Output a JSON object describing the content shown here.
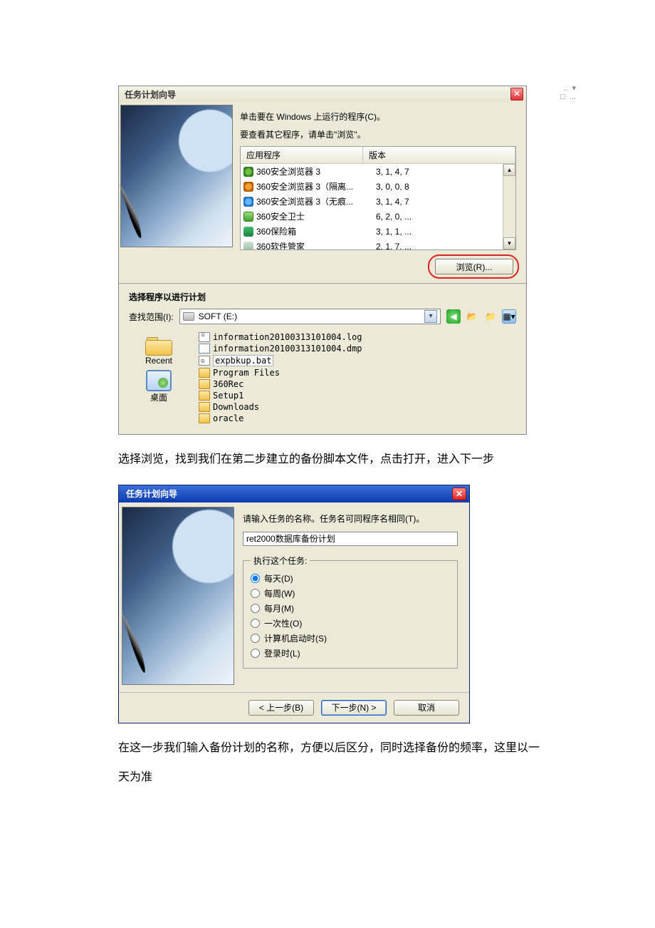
{
  "dlg1": {
    "title": "任务计划向导",
    "extra_icons": ".. ▾\n□ ...",
    "msg1": "单击要在 Windows 上运行的程序(C)。",
    "msg2": "要查看其它程序，请单击\"浏览\"。",
    "cols": {
      "app": "应用程序",
      "ver": "版本"
    },
    "rows": [
      {
        "name": "360安全浏览器 3",
        "ver": "3, 1, 4, 7"
      },
      {
        "name": "360安全浏览器 3（隔离...",
        "ver": "3, 0, 0, 8"
      },
      {
        "name": "360安全浏览器 3（无痕...",
        "ver": "3, 1, 4, 7"
      },
      {
        "name": "360安全卫士",
        "ver": "6, 2, 0, ..."
      },
      {
        "name": "360保险箱",
        "ver": "3, 1, 1, ..."
      },
      {
        "name": "360软件管家",
        "ver": "2, 1, 7, ..."
      }
    ],
    "browse": "浏览(R)..."
  },
  "filedlg": {
    "title": "选择程序以进行计划",
    "look_label": "查找范围(I):",
    "drive": "SOFT (E:)",
    "places": {
      "recent": "Recent",
      "desktop": "桌面"
    },
    "files": [
      {
        "kind": "log",
        "name": "information20100313101004.log"
      },
      {
        "kind": "dmp",
        "name": "information20100313101004.dmp"
      },
      {
        "kind": "bat",
        "name": "expbkup.bat",
        "selected": true
      },
      {
        "kind": "fold",
        "name": "Program Files"
      },
      {
        "kind": "fold",
        "name": "360Rec"
      },
      {
        "kind": "fold",
        "name": "Setup1"
      },
      {
        "kind": "fold",
        "name": "Downloads"
      },
      {
        "kind": "fold",
        "name": "oracle"
      }
    ]
  },
  "text1": "选择浏览，找到我们在第二步建立的备份脚本文件，点击打开，进入下一步",
  "dlg2": {
    "title": "任务计划向导",
    "msg": "请输入任务的名称。任务名可同程序名相同(T)。",
    "input": "ret2000数据库备份计划",
    "legend": "执行这个任务:",
    "radios": [
      {
        "label": "每天(D)",
        "checked": true
      },
      {
        "label": "每周(W)"
      },
      {
        "label": "每月(M)"
      },
      {
        "label": "一次性(O)"
      },
      {
        "label": "计算机启动时(S)"
      },
      {
        "label": "登录时(L)"
      }
    ],
    "back": "< 上一步(B)",
    "next": "下一步(N) >",
    "cancel": "取消"
  },
  "text2": "在这一步我们输入备份计划的名称，方便以后区分，同时选择备份的频率，这里以一天为准"
}
